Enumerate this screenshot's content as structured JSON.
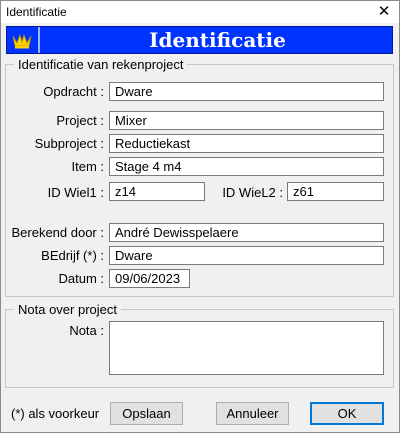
{
  "window": {
    "title": "Identificatie",
    "close_glyph": "✕"
  },
  "banner": {
    "heading": "Identificatie",
    "logo_icon": "crown-logo",
    "background": "#0033ff"
  },
  "project_group": {
    "legend": "Identificatie van rekenproject",
    "opdracht": {
      "label": "Opdracht :",
      "value": "Dware"
    },
    "project": {
      "label": "Project :",
      "value": "Mixer"
    },
    "subproject": {
      "label": "Subproject :",
      "value": "Reductiekast"
    },
    "item": {
      "label": "Item :",
      "value": "Stage 4 m4"
    },
    "id_wiel1": {
      "label": "ID Wiel1 :",
      "value": "z14"
    },
    "id_wiel2": {
      "label": "ID WieL2 :",
      "value": "z61"
    },
    "berekend_door": {
      "label": "Berekend door :",
      "value": "André Dewisspelaere"
    },
    "bedrijf": {
      "label": "BEdrijf (*) :",
      "value": "Dware"
    },
    "datum": {
      "label": "Datum :",
      "value": "09/06/2023"
    }
  },
  "nota_group": {
    "legend": "Nota over project",
    "nota": {
      "label": "Nota :",
      "value": ""
    }
  },
  "footer": {
    "note": "(*) als voorkeur",
    "save_label": "Opslaan",
    "cancel_label": "Annuleer",
    "ok_label": "OK"
  }
}
